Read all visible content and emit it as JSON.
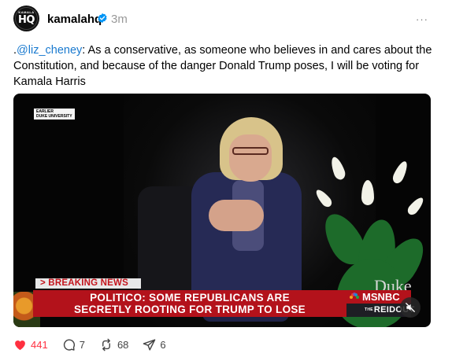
{
  "post": {
    "username": "kamalahq",
    "timestamp": "3m",
    "more_label": "···",
    "avatar": {
      "top_text": "KAMALA",
      "main_text": "HQ"
    },
    "text_prefix": ".",
    "mention": "@liz_cheney",
    "text_body": ": As a conservative, as someone who believes in and cares about the Constitution, and because of the danger Donald Trump poses, I will be voting for Kamala Harris"
  },
  "video": {
    "earlier_badge": "EARLIER",
    "location_badge": "DUKE UNIVERSITY",
    "breaking_label": "> BREAKING NEWS",
    "headline_line1": "POLITICO: SOME REPUBLICANS ARE",
    "headline_line2": "SECRETLY ROOTING FOR TRUMP TO LOSE",
    "network": "MSNBC",
    "show_prefix": "THE",
    "show_name": "REIDOUT",
    "venue_watermark": "Duke",
    "mute_icon": "speaker-muted-icon"
  },
  "actions": {
    "likes": "441",
    "replies": "7",
    "reposts": "68",
    "shares": "6"
  },
  "colors": {
    "like_red": "#ff3040",
    "mention_blue": "#1a7acf",
    "verified_blue": "#0095f6",
    "chyron_red": "#b3121b"
  }
}
